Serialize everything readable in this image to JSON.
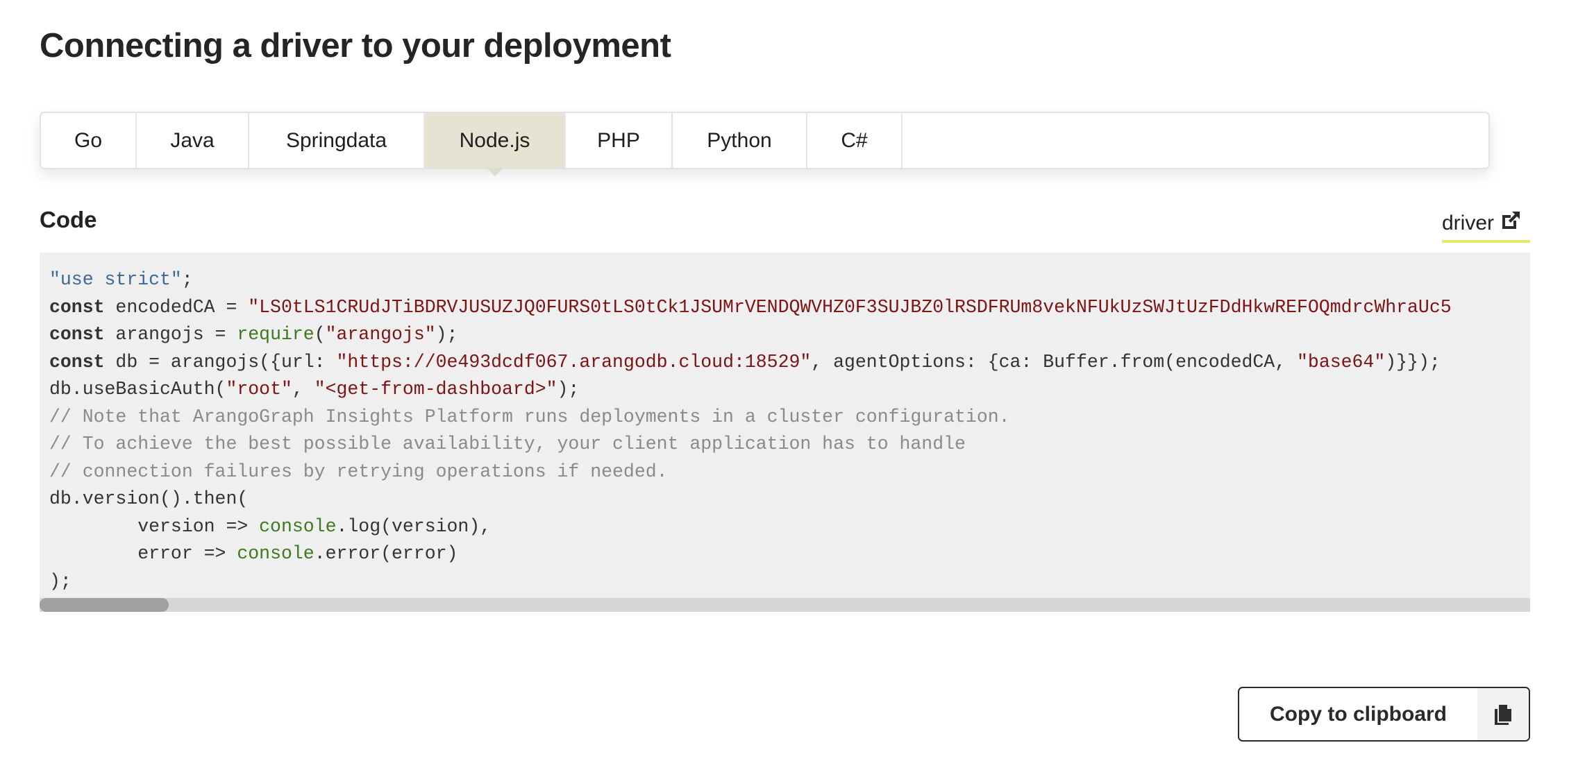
{
  "page": {
    "title": "Connecting a driver to your deployment"
  },
  "tabs": [
    {
      "label": "Go",
      "active": false
    },
    {
      "label": "Java",
      "active": false
    },
    {
      "label": "Springdata",
      "active": false
    },
    {
      "label": "Node.js",
      "active": true
    },
    {
      "label": "PHP",
      "active": false
    },
    {
      "label": "Python",
      "active": false
    },
    {
      "label": "C#",
      "active": false
    }
  ],
  "code_section": {
    "heading": "Code",
    "driver_link_label": "driver",
    "driver_link_icon": "external-link-icon",
    "lines": {
      "l1_str": "\"use strict\"",
      "l1_tail": ";",
      "kw_const": "const",
      "l2_mid": " encodedCA = ",
      "l2_str": "\"LS0tLS1CRUdJTiBDRVJUSUZJQ0FURS0tLS0tCk1JSUMrVENDQWVHZ0F3SUJBZ0lRSDFRUm8vekNFUkUzSWJtUzFDdHkwREFOQmdrcWhraUc5",
      "l3_mid": " arangojs = ",
      "l3_fn": "require",
      "l3_open": "(",
      "l3_str": "\"arangojs\"",
      "l3_tail": ");",
      "l4_mid": " db = arangojs({url: ",
      "l4_str": "\"https://0e493dcdf067.arangodb.cloud:18529\"",
      "l4_mid2": ", agentOptions: {ca: Buffer.from(encodedCA, ",
      "l4_str2": "\"base64\"",
      "l4_tail": ")}});",
      "l5_head": "db.useBasicAuth(",
      "l5_str1": "\"root\"",
      "l5_mid": ", ",
      "l5_str2": "\"<get-from-dashboard>\"",
      "l5_tail": ");",
      "c1": "// Note that ArangoGraph Insights Platform runs deployments in a cluster configuration.",
      "c2": "// To achieve the best possible availability, your client application has to handle",
      "c3": "// connection failures by retrying operations if needed.",
      "l9": "db.version().then(",
      "l10_head": "        version => ",
      "l10_fn": "console",
      "l10_tail": ".log(version),",
      "l11_head": "        error => ",
      "l11_fn": "console",
      "l11_tail": ".error(error)",
      "l12": ");"
    },
    "scroll_position": 0.0
  },
  "copy_button": {
    "label": "Copy to clipboard",
    "icon": "copy-icon"
  },
  "colors": {
    "active_tab_bg": "#e5e4d3",
    "link_underline": "#e4e86a",
    "string": "#7d1414",
    "builtin": "#3c7a1e",
    "comment": "#8a8a8a",
    "use_strict": "#3a6a96"
  }
}
